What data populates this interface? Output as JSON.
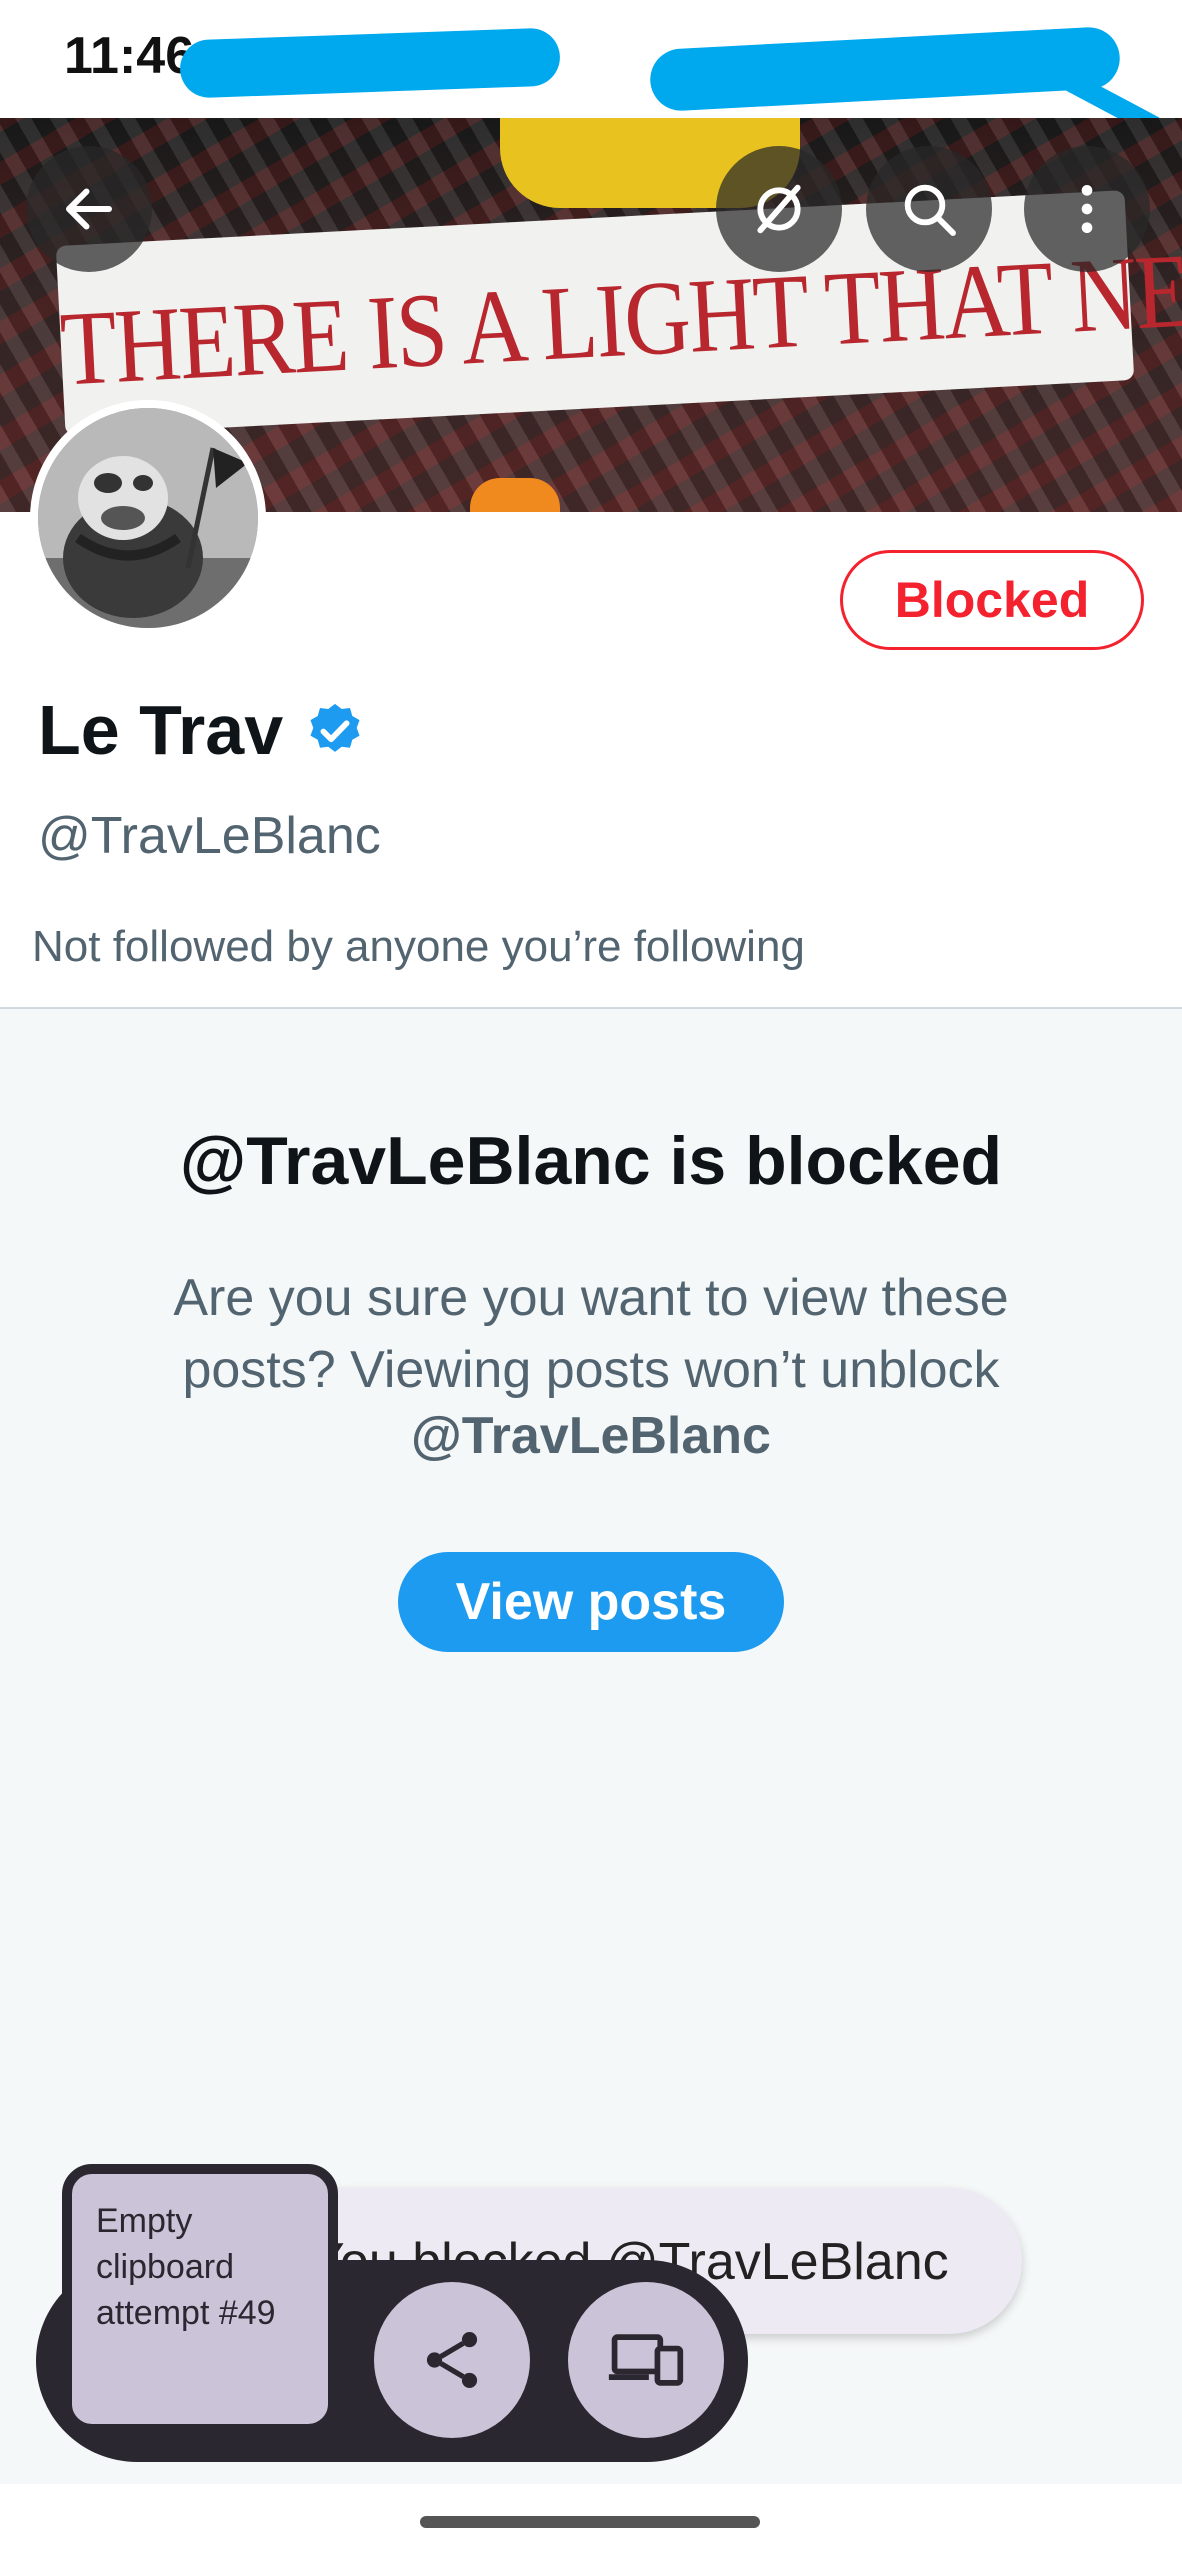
{
  "status_bar": {
    "time": "11:46"
  },
  "banner": {
    "text": "THERE IS A LIGHT THAT NEVER GOES OUT"
  },
  "header_actions": {
    "back": "back-arrow-icon",
    "grok": "grok-icon",
    "search": "search-icon",
    "more": "more-vertical-icon"
  },
  "profile": {
    "display_name": "Le Trav",
    "handle": "@TravLeBlanc",
    "blocked_label": "Blocked",
    "followers_note": "Not followed by anyone you’re following",
    "verified_color": "#1d9bf0"
  },
  "blocked_notice": {
    "title": "@TravLeBlanc is blocked",
    "message": "Are you sure you want to view these posts? Viewing posts won’t unblock",
    "handle": "@TravLeBlanc",
    "button": "View posts"
  },
  "toast": {
    "text": "You blocked @TravLeBlanc"
  },
  "clipboard_overlay": {
    "card_text": "Empty clipboard attempt #49",
    "share_icon": "share-icon",
    "devices_icon": "devices-icon"
  },
  "colors": {
    "accent": "#1d9bf0",
    "danger": "#f4212e"
  }
}
